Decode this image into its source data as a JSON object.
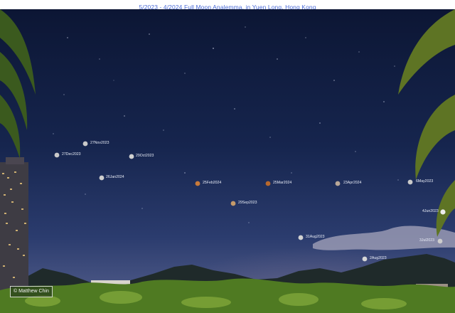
{
  "title": "5/2023 - 4/2024 Full Moon Analemma, in Yuen Long, Hong Kong",
  "credit": "© Matthew Chin",
  "moons": {
    "m1": {
      "label": "27Nov2023",
      "color": "#c9c9c9"
    },
    "m2": {
      "label": "27Dec2023",
      "color": "#c9c9c9"
    },
    "m3": {
      "label": "29Oct2023",
      "color": "#d0d0d0"
    },
    "m4": {
      "label": "26Jan2024",
      "color": "#cfcfcf"
    },
    "m5": {
      "label": "25Feb2024",
      "color": "#c87a3a"
    },
    "m6": {
      "label": "25Mar2024",
      "color": "#b8682c"
    },
    "m7": {
      "label": "23Apr2024",
      "color": "#b9a898"
    },
    "m8": {
      "label": "6May2023",
      "color": "#c9c9c9"
    },
    "m9": {
      "label": "29Sep2023",
      "color": "#c49a6a"
    },
    "m10": {
      "label": "4Jun2023",
      "color": "#ececec"
    },
    "m11": {
      "label": "31Aug2023",
      "color": "#d2d2d2"
    },
    "m12": {
      "label": "3Jul2023",
      "color": "#cccccc"
    },
    "m13": {
      "label": "2Aug2023",
      "color": "#d6d6d6"
    }
  }
}
